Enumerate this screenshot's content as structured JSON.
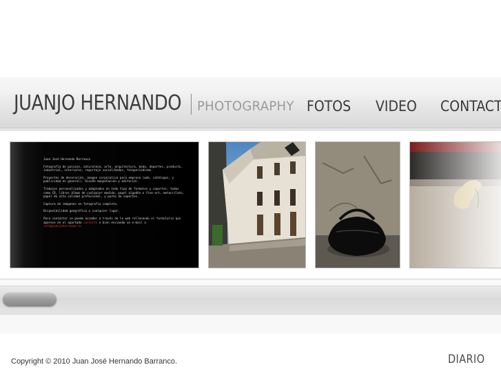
{
  "header": {
    "logo_name": "JUANJO HERNANDO",
    "logo_sub": "PHOTOGRAPHY",
    "nav": [
      {
        "label": "FOTOS"
      },
      {
        "label": "VIDEO"
      },
      {
        "label": "CONTACTO"
      }
    ]
  },
  "gallery": {
    "about_text": {
      "title": "Juan José Hernando Barranco",
      "p1": "Fotografía de paisaje, naturaleza, arte, arquitectura, moda, deportes, producto, industrial, interiores, reportaje social/bodas, fotoperiodismo.",
      "p2": "Proyectos de decoración, imagen corporativa para empresa (web, catálogos, y publicidad en general). Diseño maquetación y editorial.",
      "p3": "Trabajos personalizados y adaptados en todo tipo de formatos y soportes: todos como CD, libros álbum de cualquier medida, papel algodón o fine-art, metacrilato, papel de alta calidad profesional, y punto de soportes.",
      "p4": "Captura de imágenes en fotografía completa.",
      "p5": "Disponibilidad geográfica a cualquier lugar.",
      "p6": "Para contactar se puede acceder a través de la web rellenando el formulario que aparece en el apartado",
      "p6_link": "contacto",
      "p6_end": "o bien enviando un e-mail a",
      "email": "info@juanjohernando.es"
    }
  },
  "footer": {
    "copyright": "Copyright © 2010 Juan José Hernando Barranco.",
    "diario": "DIARIO"
  }
}
